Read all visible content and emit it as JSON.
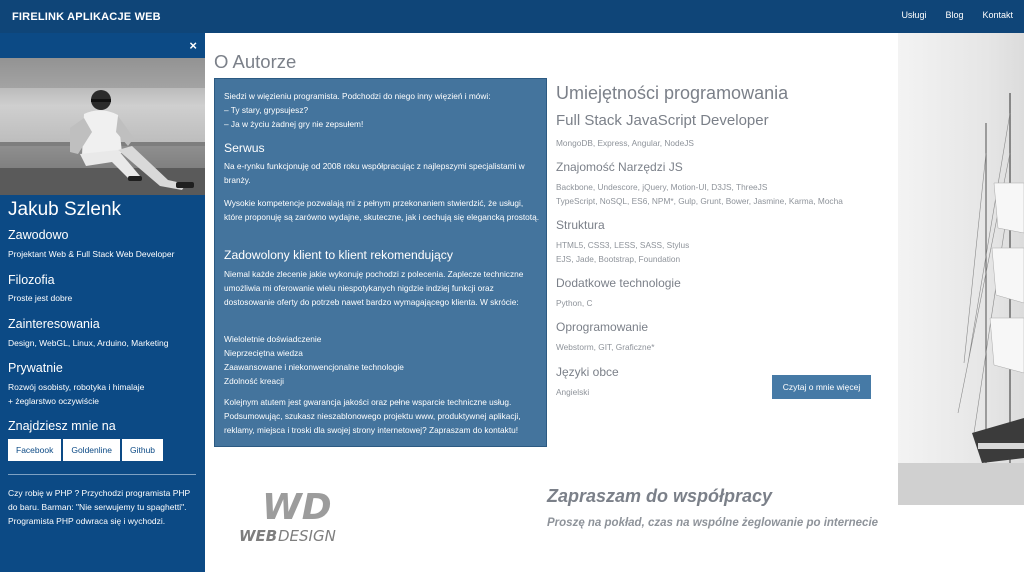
{
  "header": {
    "brand": "FIRELINK APLIKACJE WEB",
    "nav": [
      "Usługi",
      "Blog",
      "Kontakt"
    ]
  },
  "sidebar": {
    "close_glyph": "×",
    "name": "Jakub Szlenk",
    "sections": [
      {
        "title": "Zawodowo",
        "text": "Projektant Web & Full Stack Web Developer"
      },
      {
        "title": "Filozofia",
        "text": "Proste jest dobre"
      },
      {
        "title": "Zainteresowania",
        "text": "Design, WebGL, Linux, Arduino, Marketing"
      },
      {
        "title": "Prywatnie",
        "text": "Rozwój osobisty, robotyka i himalaje\n+ żeglarstwo oczywiście"
      }
    ],
    "find_me_title": "Znajdziesz mnie na",
    "social_buttons": [
      "Facebook",
      "Goldenline",
      "Github"
    ],
    "joke": "Czy robię w PHP ? Przychodzi programista PHP do baru. Barman: \"Nie serwujemy tu spaghetti\". Programista PHP odwraca się i wychodzi."
  },
  "main": {
    "title": "O Autorze",
    "intro": "Siedzi w więzieniu programista. Podchodzi do niego inny więzień i mówi:\n– Ty stary, grypsujesz?\n– Ja w życiu żadnej gry nie zepsułem!",
    "serwus_title": "Serwus",
    "serwus_p1": "Na e-rynku funkcjonuję od 2008 roku współpracując z najlepszymi specjalistami w branży.",
    "serwus_p2": "Wysokie kompetencje pozwalają mi z pełnym przekonaniem stwierdzić, że usługi, które proponuję są zarówno wydajne, skuteczne, jak i cechują się elegancką prostotą.",
    "client_title": "Zadowolony klient to klient rekomendujący",
    "client_p1": "Niemal każde zlecenie jakie wykonuję pochodzi z polecenia. Zaplecze techniczne umożliwia mi oferowanie wielu niespotykanych nigdzie indziej funkcji oraz dostosowanie oferty do potrzeb nawet bardzo wymagającego klienta. W skrócie:",
    "client_list": "Wieloletnie doświadczenie\nNieprzeciętna wiedza\nZaawansowane i niekonwencjonalne technologie\nZdolność kreacji",
    "client_p2": "Kolejnym atutem jest gwarancja jakości oraz pełne wsparcie techniczne usług. Podsumowując, szukasz nieszablonowego projektu www, produktywnej aplikacji, reklamy, miejsca i troski dla swojej strony internetowej? Zapraszam do kontaktu!",
    "skills": {
      "title": "Umiejętności programowania",
      "fullstack_title": "Full Stack JavaScript Developer",
      "fullstack_text": "MongoDB, Express, Angular, NodeJS",
      "js_title": "Znajomość Narzędzi JS",
      "js_text": "Backbone, Undescore, jQuery, Motion-UI, D3JS, ThreeJS\nTypeScript, NoSQL, ES6, NPM*, Gulp, Grunt, Bower, Jasmine, Karma, Mocha",
      "struct_title": "Struktura",
      "struct_text": "HTML5, CSS3, LESS, SASS, Stylus\nEJS, Jade, Bootstrap, Foundation",
      "extra_title": "Dodatkowe technologie",
      "extra_text": "Python, C",
      "soft_title": "Oprogramowanie",
      "soft_text": "Webstorm, GIT, Graficzne*",
      "lang_title": "Języki obce",
      "lang_text": "Angielski",
      "more_button": "Czytaj o mnie więcej"
    },
    "logo": {
      "top": "WD",
      "bottom_bold": "WEB",
      "bottom_italic": "DESIGN"
    },
    "promo": "Zapraszam do współpracy",
    "promo_sub": "Proszę na pokład, czas na wspólne żeglowanie po internecie"
  },
  "colors": {
    "topbar": "#0f4578",
    "sidebar": "#0c4a85",
    "box": "#44749d",
    "accent_button": "#467aa6",
    "text_gray": "#7b8089"
  }
}
